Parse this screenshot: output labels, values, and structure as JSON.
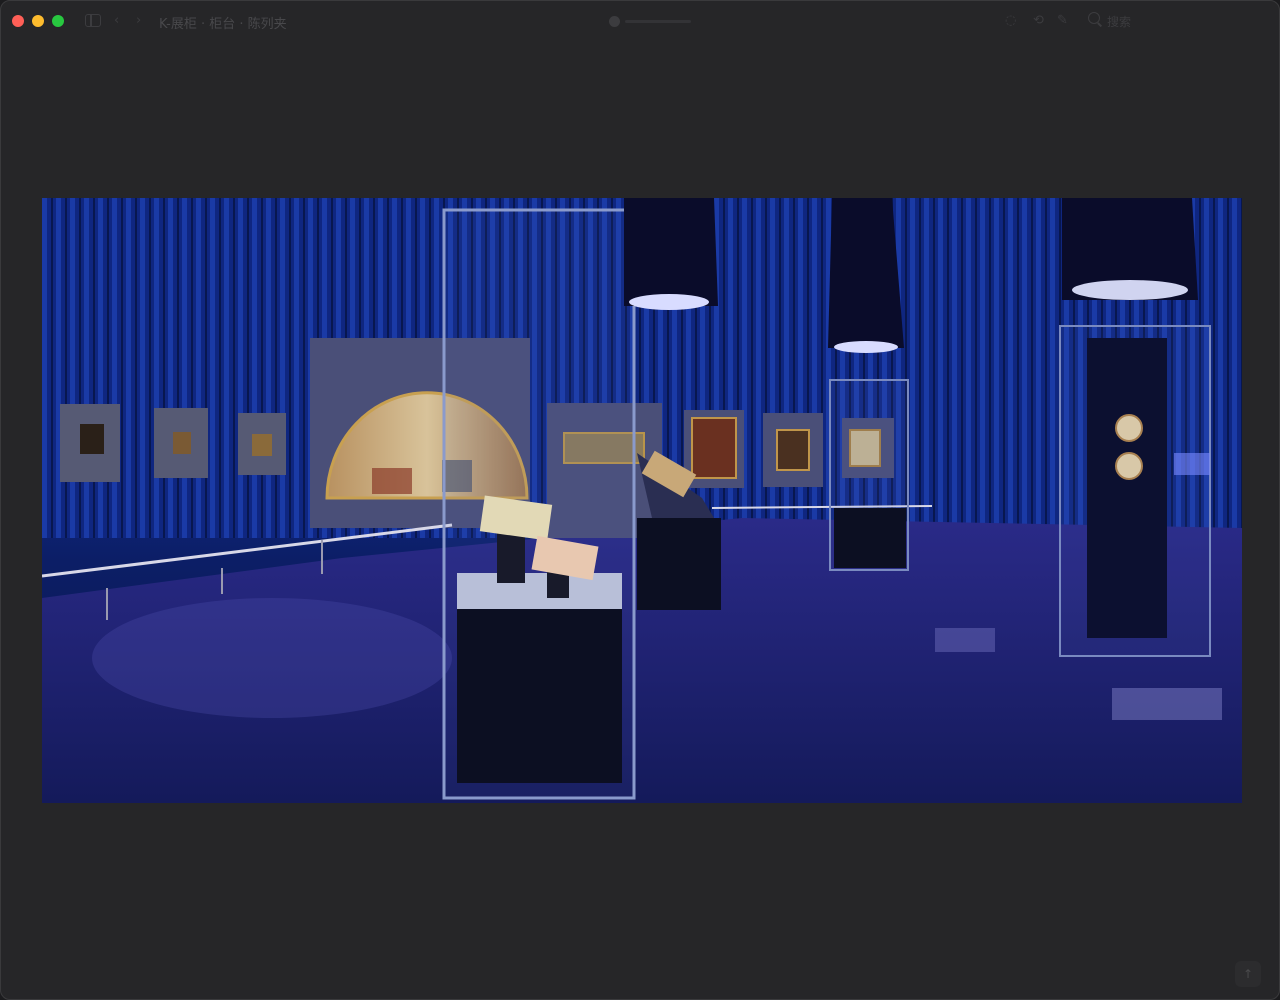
{
  "window": {
    "title": "K-展柜 · 柜台 · 陈列夹",
    "search_label": "搜索",
    "icons": [
      "sidebar-toggle-icon",
      "chevron-left-icon",
      "chevron-right-icon",
      "zoom-slider",
      "share-icon",
      "rotate-icon",
      "markup-icon",
      "search-icon",
      "scroll-up-icon"
    ]
  },
  "image": {
    "subject": "Museum exhibition hall with blue curtains, framed paintings and glass display cases"
  },
  "colors": {
    "window_bg": "#262628",
    "curtain_blue": "#102a8a",
    "floor_blue": "#1a1f6e"
  }
}
